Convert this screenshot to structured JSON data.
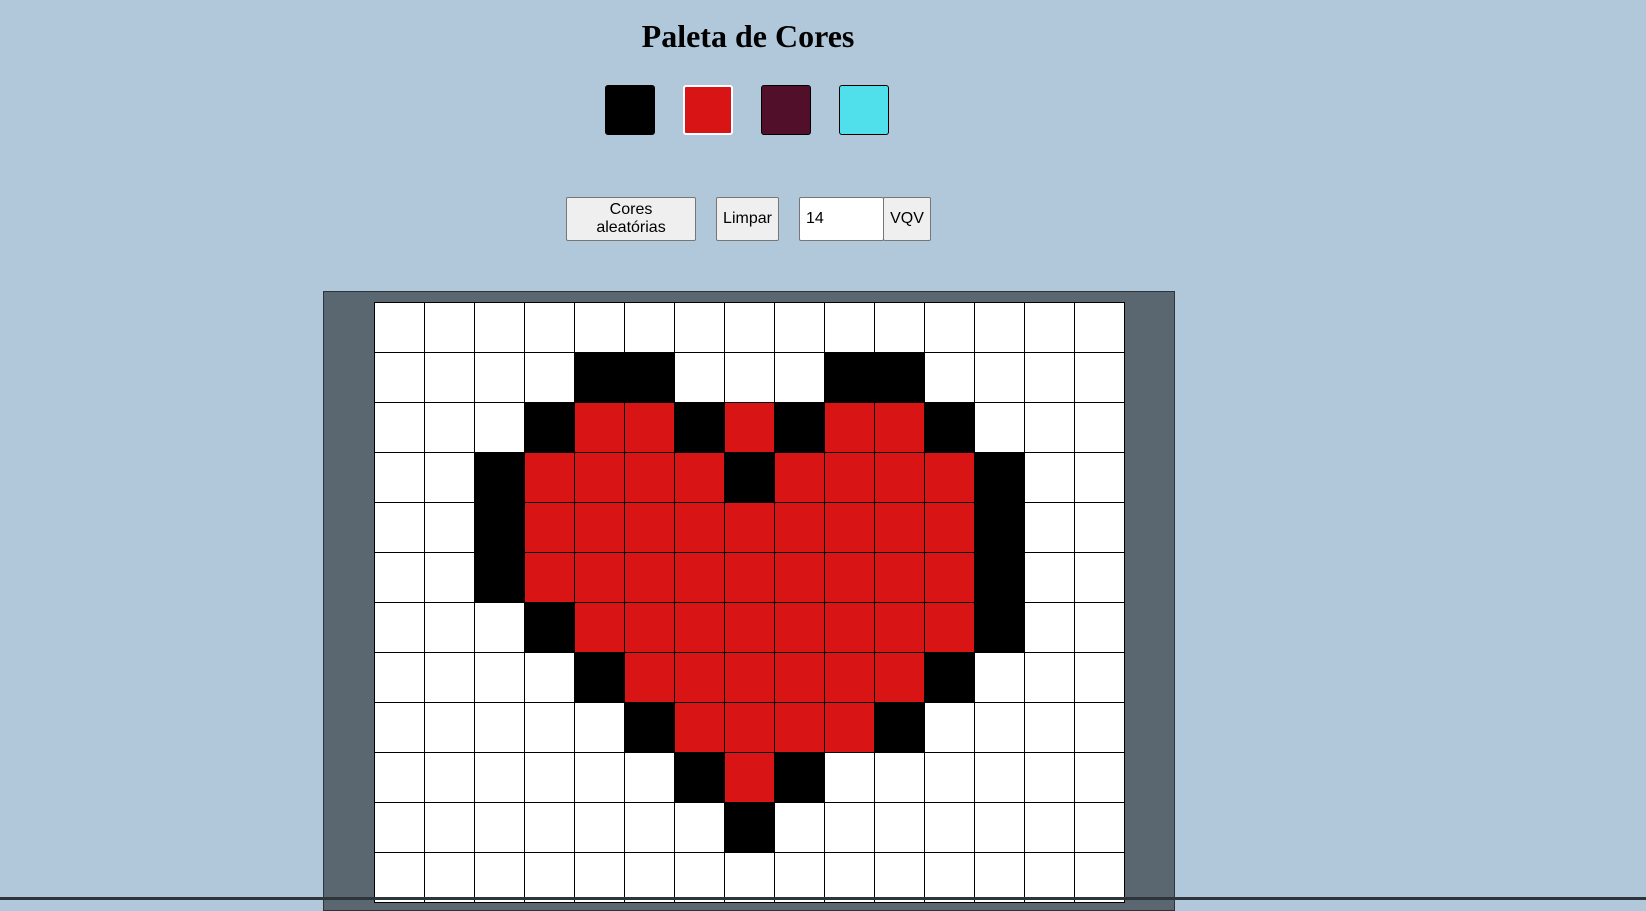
{
  "header": {
    "title": "Paleta de Cores"
  },
  "palette": {
    "colors": [
      "#000000",
      "#d81414",
      "#520f2a",
      "#4fe0ec"
    ],
    "selected_index": 1
  },
  "controls": {
    "random_colors_label": "Cores aleatórias",
    "clear_label": "Limpar",
    "board_size_value": "14",
    "generate_board_label": "VQV"
  },
  "board": {
    "colors": {
      "0": "#ffffff",
      "1": "#000000",
      "2": "#d81414"
    },
    "rows": [
      "000000000000000",
      "000011000110000",
      "000122121221000",
      "001222212222100",
      "001222222222100",
      "001222222222100",
      "000122222222100",
      "000012222221000",
      "000001222210000",
      "000000121000000",
      "000000010000000",
      "000000000000000"
    ]
  }
}
